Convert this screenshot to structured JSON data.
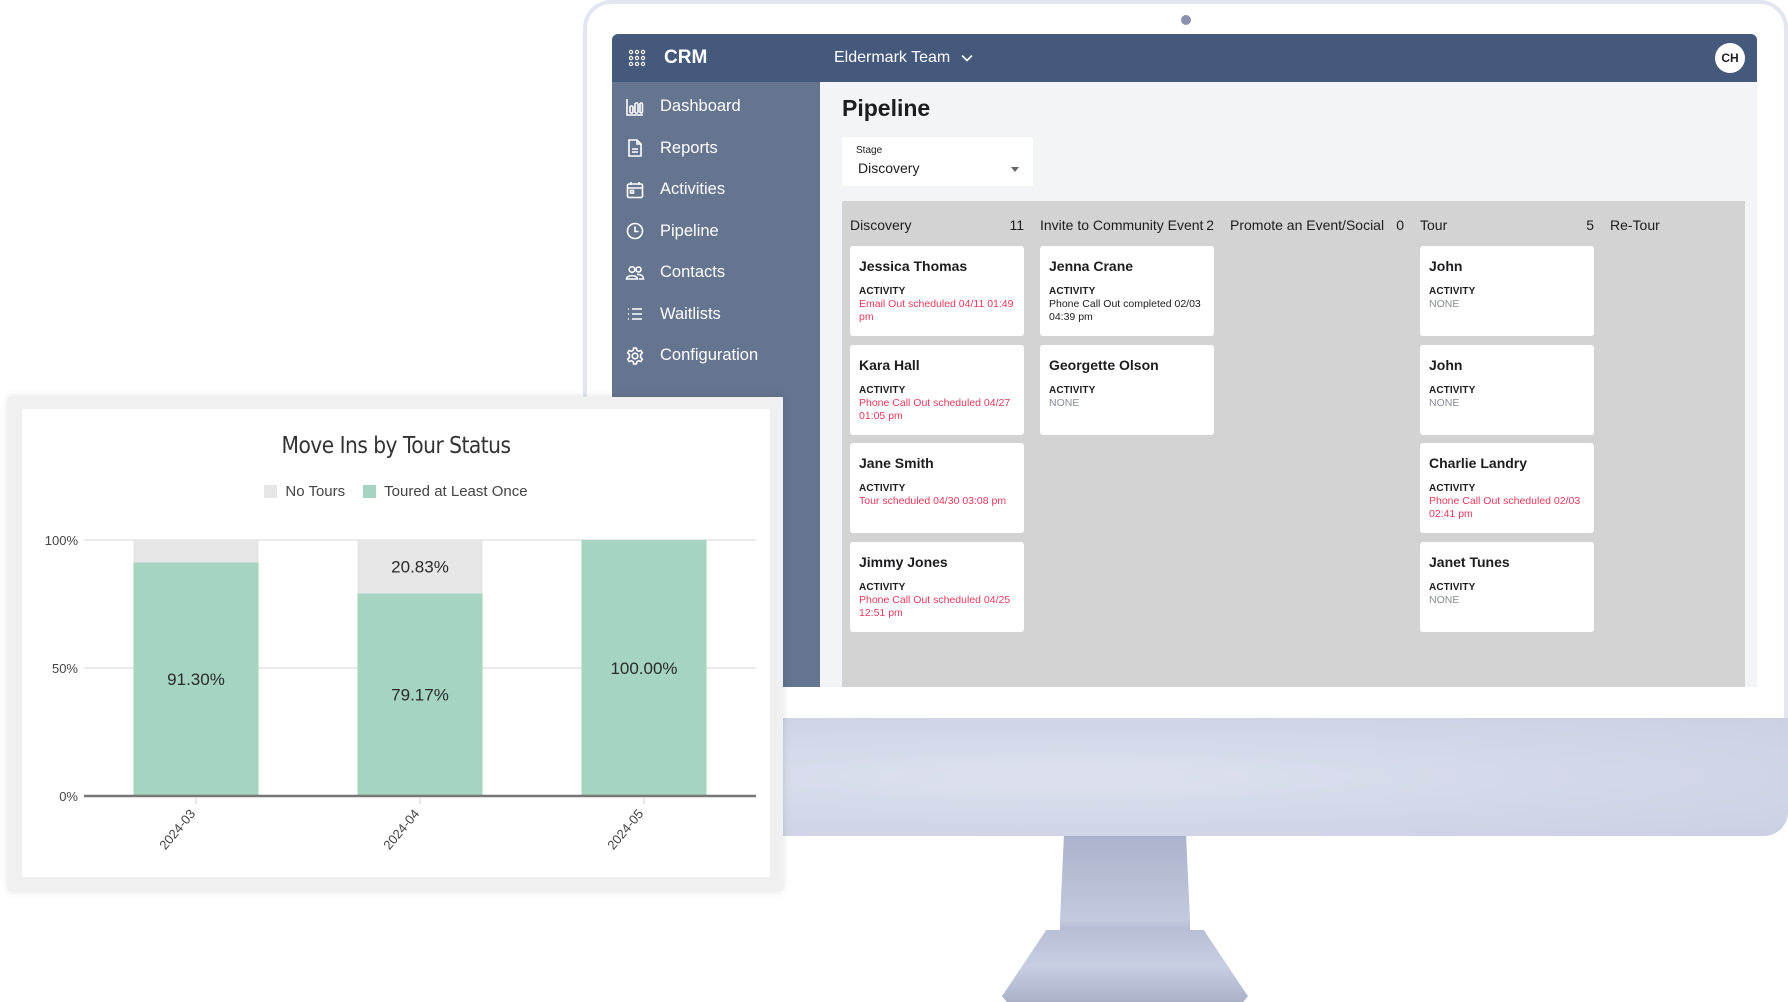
{
  "app": {
    "title": "CRM",
    "team": "Eldermark Team",
    "avatar_initials": "CH"
  },
  "sidebar": {
    "items": [
      {
        "label": "Dashboard",
        "icon": "bar-chart-icon"
      },
      {
        "label": "Reports",
        "icon": "document-icon"
      },
      {
        "label": "Activities",
        "icon": "calendar-icon"
      },
      {
        "label": "Pipeline",
        "icon": "clock-icon"
      },
      {
        "label": "Contacts",
        "icon": "people-icon"
      },
      {
        "label": "Waitlists",
        "icon": "list-icon"
      },
      {
        "label": "Configuration",
        "icon": "gear-icon"
      }
    ]
  },
  "page": {
    "title": "Pipeline",
    "stage_filter": {
      "label": "Stage",
      "value": "Discovery"
    }
  },
  "board": {
    "activity_label": "ACTIVITY",
    "columns": [
      {
        "title": "Discovery",
        "count": "11",
        "cards": [
          {
            "name": "Jessica Thomas",
            "activity": "Email Out scheduled 04/11 01:49 pm",
            "status": "red"
          },
          {
            "name": "Kara Hall",
            "activity": "Phone Call Out scheduled 04/27 01:05 pm",
            "status": "red"
          },
          {
            "name": "Jane Smith",
            "activity": "Tour scheduled 04/30 03:08 pm",
            "status": "red"
          },
          {
            "name": "Jimmy Jones",
            "activity": "Phone Call Out scheduled 04/25 12:51 pm",
            "status": "red"
          }
        ]
      },
      {
        "title": "Invite to Community Event",
        "count": "2",
        "cards": [
          {
            "name": "Jenna Crane",
            "activity": "Phone Call Out completed 02/03 04:39 pm",
            "status": "dark"
          },
          {
            "name": "Georgette Olson",
            "activity": "NONE",
            "status": "gray"
          }
        ]
      },
      {
        "title": "Promote an Event/Social",
        "count": "0",
        "cards": []
      },
      {
        "title": "Tour",
        "count": "5",
        "cards": [
          {
            "name": "John",
            "activity": "NONE",
            "status": "gray"
          },
          {
            "name": "John",
            "activity": "NONE",
            "status": "gray"
          },
          {
            "name": "Charlie Landry",
            "activity": "Phone Call Out scheduled 02/03 02:41 pm",
            "status": "red"
          },
          {
            "name": "Janet Tunes",
            "activity": "NONE",
            "status": "gray"
          }
        ]
      },
      {
        "title": "Re-Tour",
        "count": "",
        "cards": []
      }
    ]
  },
  "colors": {
    "topbar": "#44597c",
    "sidebar": "#65758f",
    "activity_overdue": "#ea3a5e",
    "no_tours": "#e6e6e6",
    "toured": "#a5d4c1"
  },
  "chart_data": {
    "type": "bar",
    "stacked": true,
    "title": "Move Ins by Tour Status",
    "xlabel": "",
    "ylabel": "",
    "categories": [
      "2024-03",
      "2024-04",
      "2024-05"
    ],
    "series": [
      {
        "name": "Toured at Least Once",
        "color": "#a5d4c1",
        "values": [
          91.3,
          79.17,
          100.0
        ],
        "labels": [
          "91.30%",
          "79.17%",
          "100.00%"
        ]
      },
      {
        "name": "No Tours",
        "color": "#e6e6e6",
        "values": [
          8.7,
          20.83,
          0.0
        ],
        "labels": [
          "",
          "20.83%",
          ""
        ]
      }
    ],
    "legend": [
      "No Tours",
      "Toured at Least Once"
    ],
    "legend_position": "top-center",
    "yticks": [
      "0%",
      "50%",
      "100%"
    ],
    "ylim": [
      0,
      100
    ],
    "grid": true
  }
}
